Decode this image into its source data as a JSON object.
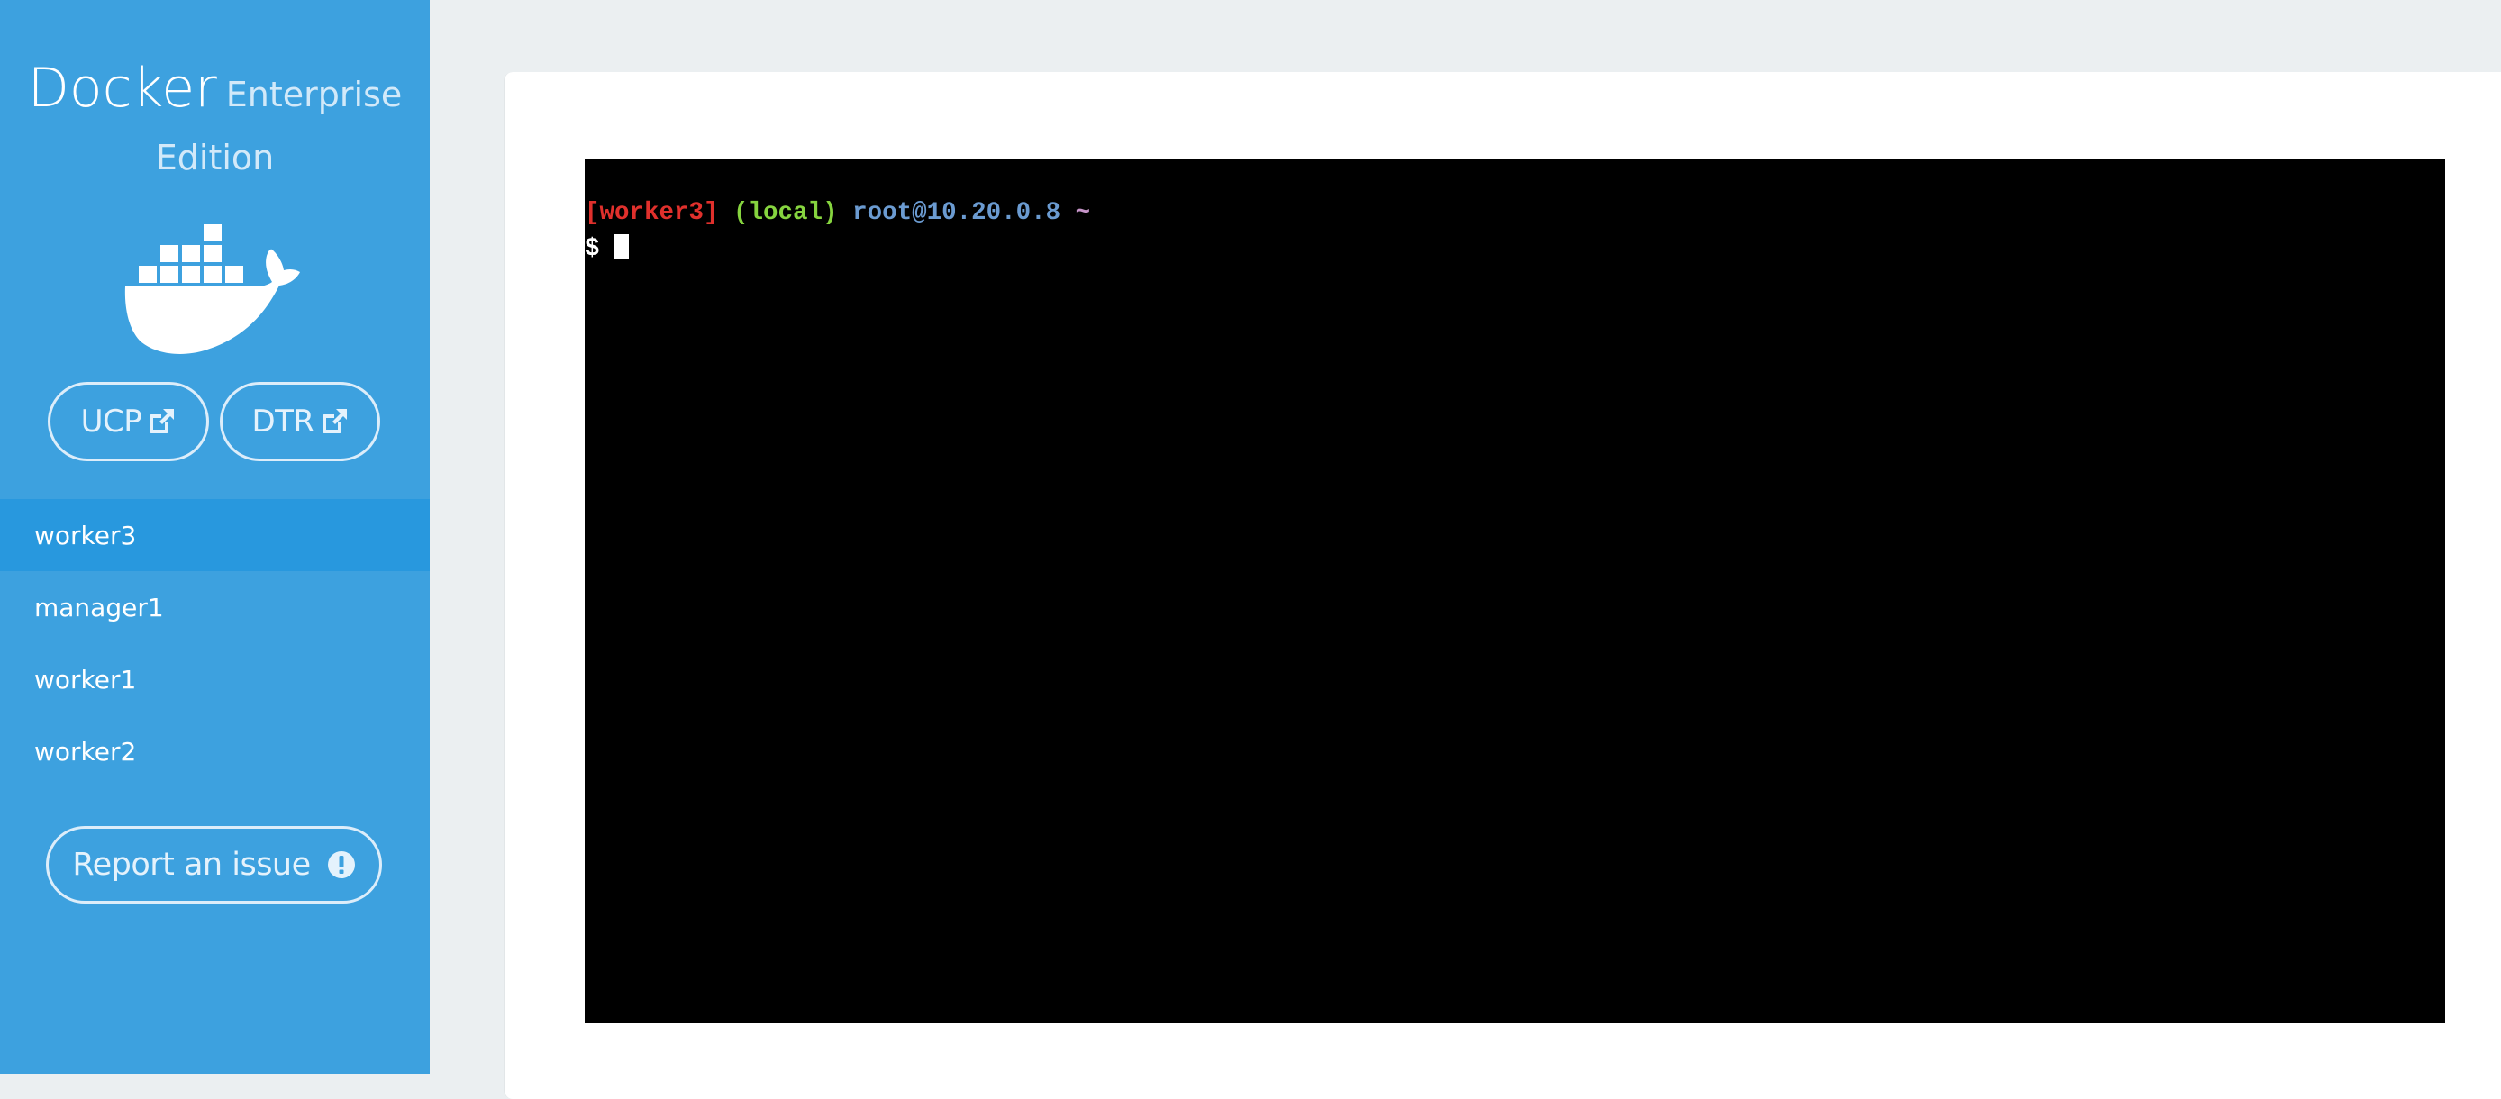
{
  "sidebar": {
    "brand": {
      "name": "Docker",
      "edition_line1": "Enterprise",
      "edition_line2": "Edition",
      "logo_icon": "docker-whale-icon"
    },
    "links": [
      {
        "label": "UCP",
        "icon": "external-link-icon"
      },
      {
        "label": "DTR",
        "icon": "external-link-icon"
      }
    ],
    "nodes": [
      {
        "label": "worker3",
        "active": true
      },
      {
        "label": "manager1",
        "active": false
      },
      {
        "label": "worker1",
        "active": false
      },
      {
        "label": "worker2",
        "active": false
      }
    ],
    "report_button": {
      "label": "Report an issue",
      "icon": "exclamation-circle-icon"
    }
  },
  "terminal": {
    "prompt": {
      "host": "[worker3]",
      "context": "(local)",
      "user_at_ip": "root@10.20.0.8",
      "path": "~",
      "symbol": "$"
    },
    "colors": {
      "host": "#e0302c",
      "context": "#86d43f",
      "user_at_ip": "#6b9bd1",
      "path": "#c795c9",
      "background": "#000000"
    }
  },
  "theme": {
    "sidebar_bg": "#3da1df",
    "sidebar_active_bg": "#2898de",
    "page_bg": "#ebeff1"
  }
}
